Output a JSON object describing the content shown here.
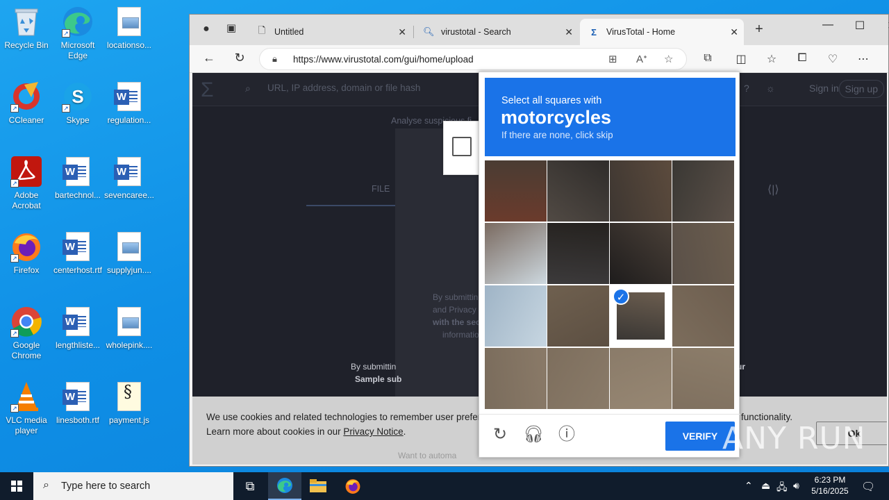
{
  "desktop": {
    "icons": [
      {
        "label": "Recycle Bin",
        "icon": "recycle-bin-icon"
      },
      {
        "label": "Microsoft Edge",
        "icon": "edge-icon"
      },
      {
        "label": "locationso...",
        "icon": "image-file-icon"
      },
      {
        "label": "CCleaner",
        "icon": "ccleaner-icon"
      },
      {
        "label": "Skype",
        "icon": "skype-icon"
      },
      {
        "label": "regulation...",
        "icon": "word-file-icon"
      },
      {
        "label": "Adobe Acrobat",
        "icon": "acrobat-icon"
      },
      {
        "label": "bartechnol...",
        "icon": "word-file-icon"
      },
      {
        "label": "sevencaree...",
        "icon": "word-file-icon"
      },
      {
        "label": "Firefox",
        "icon": "firefox-icon"
      },
      {
        "label": "centerhost.rtf",
        "icon": "word-file-icon"
      },
      {
        "label": "supplyjun....",
        "icon": "image-file-icon"
      },
      {
        "label": "Google Chrome",
        "icon": "chrome-icon"
      },
      {
        "label": "lengthliste...",
        "icon": "word-file-icon"
      },
      {
        "label": "wholepink....",
        "icon": "image-file-icon"
      },
      {
        "label": "VLC media player",
        "icon": "vlc-icon"
      },
      {
        "label": "linesboth.rtf",
        "icon": "word-file-icon"
      },
      {
        "label": "payment.js",
        "icon": "script-file-icon"
      }
    ]
  },
  "browser": {
    "tabs": [
      {
        "label": "Untitled",
        "icon": "page-icon"
      },
      {
        "label": "virustotal - Search",
        "icon": "search-icon"
      },
      {
        "label": "VirusTotal - Home",
        "icon": "virustotal-icon"
      }
    ],
    "url": "https://www.virustotal.com/gui/home/upload"
  },
  "virustotal": {
    "search_placeholder": "URL, IP address, domain or file hash",
    "sign_in": "Sign in",
    "sign_up": "Sign up",
    "analyse_text": "Analyse suspicious fi",
    "file_tab": "FILE",
    "by_submitting": "By submittin",
    "and_privacy": "and Privacy N",
    "with_the_sec": "with the sec",
    "informatio": "informatio",
    "by_submitting2": "By submittin",
    "sample_sub": "Sample sub",
    "right_ur": "ur",
    "want_to_automate": "Want to automa"
  },
  "cookie_banner": {
    "line1_start": "We use cookies and related technologies to remember user prefer",
    "line1_end": "functionality.",
    "line2_prefix": "Learn more about cookies in our ",
    "privacy_link": "Privacy Notice",
    "line2_suffix": ".",
    "ok_label": "Ok"
  },
  "captcha": {
    "instruction": "Select all squares with",
    "target": "motorcycles",
    "hint": "If there are none, click skip",
    "verify_label": "VERIFY",
    "selected_tiles": [
      10
    ],
    "footer_icons": [
      "refresh-icon",
      "audio-icon",
      "info-icon"
    ]
  },
  "watermark": "ANY RUN",
  "taskbar": {
    "search_placeholder": "Type here to search",
    "time": "6:23 PM",
    "date": "5/16/2025"
  }
}
